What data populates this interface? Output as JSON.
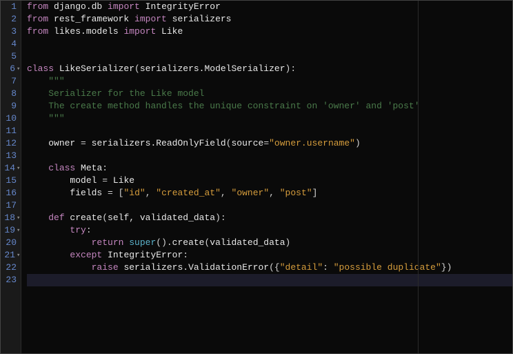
{
  "gutter": {
    "lines": [
      {
        "num": "1",
        "fold": false
      },
      {
        "num": "2",
        "fold": false
      },
      {
        "num": "3",
        "fold": false
      },
      {
        "num": "4",
        "fold": false
      },
      {
        "num": "5",
        "fold": false
      },
      {
        "num": "6",
        "fold": true
      },
      {
        "num": "7",
        "fold": false
      },
      {
        "num": "8",
        "fold": false
      },
      {
        "num": "9",
        "fold": false
      },
      {
        "num": "10",
        "fold": false
      },
      {
        "num": "11",
        "fold": false
      },
      {
        "num": "12",
        "fold": false
      },
      {
        "num": "13",
        "fold": false
      },
      {
        "num": "14",
        "fold": true
      },
      {
        "num": "15",
        "fold": false
      },
      {
        "num": "16",
        "fold": false
      },
      {
        "num": "17",
        "fold": false
      },
      {
        "num": "18",
        "fold": true
      },
      {
        "num": "19",
        "fold": true
      },
      {
        "num": "20",
        "fold": false
      },
      {
        "num": "21",
        "fold": true
      },
      {
        "num": "22",
        "fold": false
      },
      {
        "num": "23",
        "fold": false
      }
    ]
  },
  "code": {
    "line1": {
      "from": "from",
      "mod": " django.db ",
      "import": "import",
      "names": " IntegrityError"
    },
    "line2": {
      "from": "from",
      "mod": " rest_framework ",
      "import": "import",
      "names": " serializers"
    },
    "line3": {
      "from": "from",
      "mod": " likes.models ",
      "import": "import",
      "names": " Like"
    },
    "line4": "",
    "line5": "",
    "line6": {
      "class": "class",
      "name": " LikeSerializer",
      "paren_open": "(",
      "base": "serializers.ModelSerializer",
      "paren_close": ")",
      "colon": ":"
    },
    "line7": {
      "indent": "    ",
      "docstring": "\"\"\""
    },
    "line8": {
      "indent": "    ",
      "docstring": "Serializer for the Like model"
    },
    "line9": {
      "indent": "    ",
      "docstring": "The create method handles the unique constraint on 'owner' and 'post'"
    },
    "line10": {
      "indent": "    ",
      "docstring": "\"\"\""
    },
    "line11": "",
    "line12": {
      "indent": "    ",
      "lhs": "owner ",
      "eq": "=",
      "rhs1": " serializers.ReadOnlyField",
      "paren_open": "(",
      "kwarg": "source",
      "eq2": "=",
      "str": "\"owner.username\"",
      "paren_close": ")"
    },
    "line13": "",
    "line14": {
      "indent": "    ",
      "class": "class",
      "name": " Meta",
      "colon": ":"
    },
    "line15": {
      "indent": "        ",
      "lhs": "model ",
      "eq": "=",
      "rhs": " Like"
    },
    "line16": {
      "indent": "        ",
      "lhs": "fields ",
      "eq": "=",
      "sp": " ",
      "bracket_open": "[",
      "s1": "\"id\"",
      "c1": ", ",
      "s2": "\"created_at\"",
      "c2": ", ",
      "s3": "\"owner\"",
      "c3": ", ",
      "s4": "\"post\"",
      "bracket_close": "]"
    },
    "line17": "",
    "line18": {
      "indent": "    ",
      "def": "def",
      "name": " create",
      "paren_open": "(",
      "args": "self, validated_data",
      "paren_close": ")",
      "colon": ":"
    },
    "line19": {
      "indent": "        ",
      "try": "try",
      "colon": ":"
    },
    "line20": {
      "indent": "            ",
      "return": "return",
      "sp": " ",
      "super": "super",
      "paren": "().",
      "method": "create",
      "paren_open": "(",
      "arg": "validated_data",
      "paren_close": ")"
    },
    "line21": {
      "indent": "        ",
      "except": "except",
      "name": " IntegrityError",
      "colon": ":"
    },
    "line22": {
      "indent": "            ",
      "raise": "raise",
      "sp": " ",
      "obj": "serializers.ValidationError",
      "paren_open": "(",
      "brace_open": "{",
      "key": "\"detail\"",
      "colon": ": ",
      "val": "\"possible duplicate\"",
      "brace_close": "}",
      "paren_close": ")"
    },
    "line23": ""
  }
}
